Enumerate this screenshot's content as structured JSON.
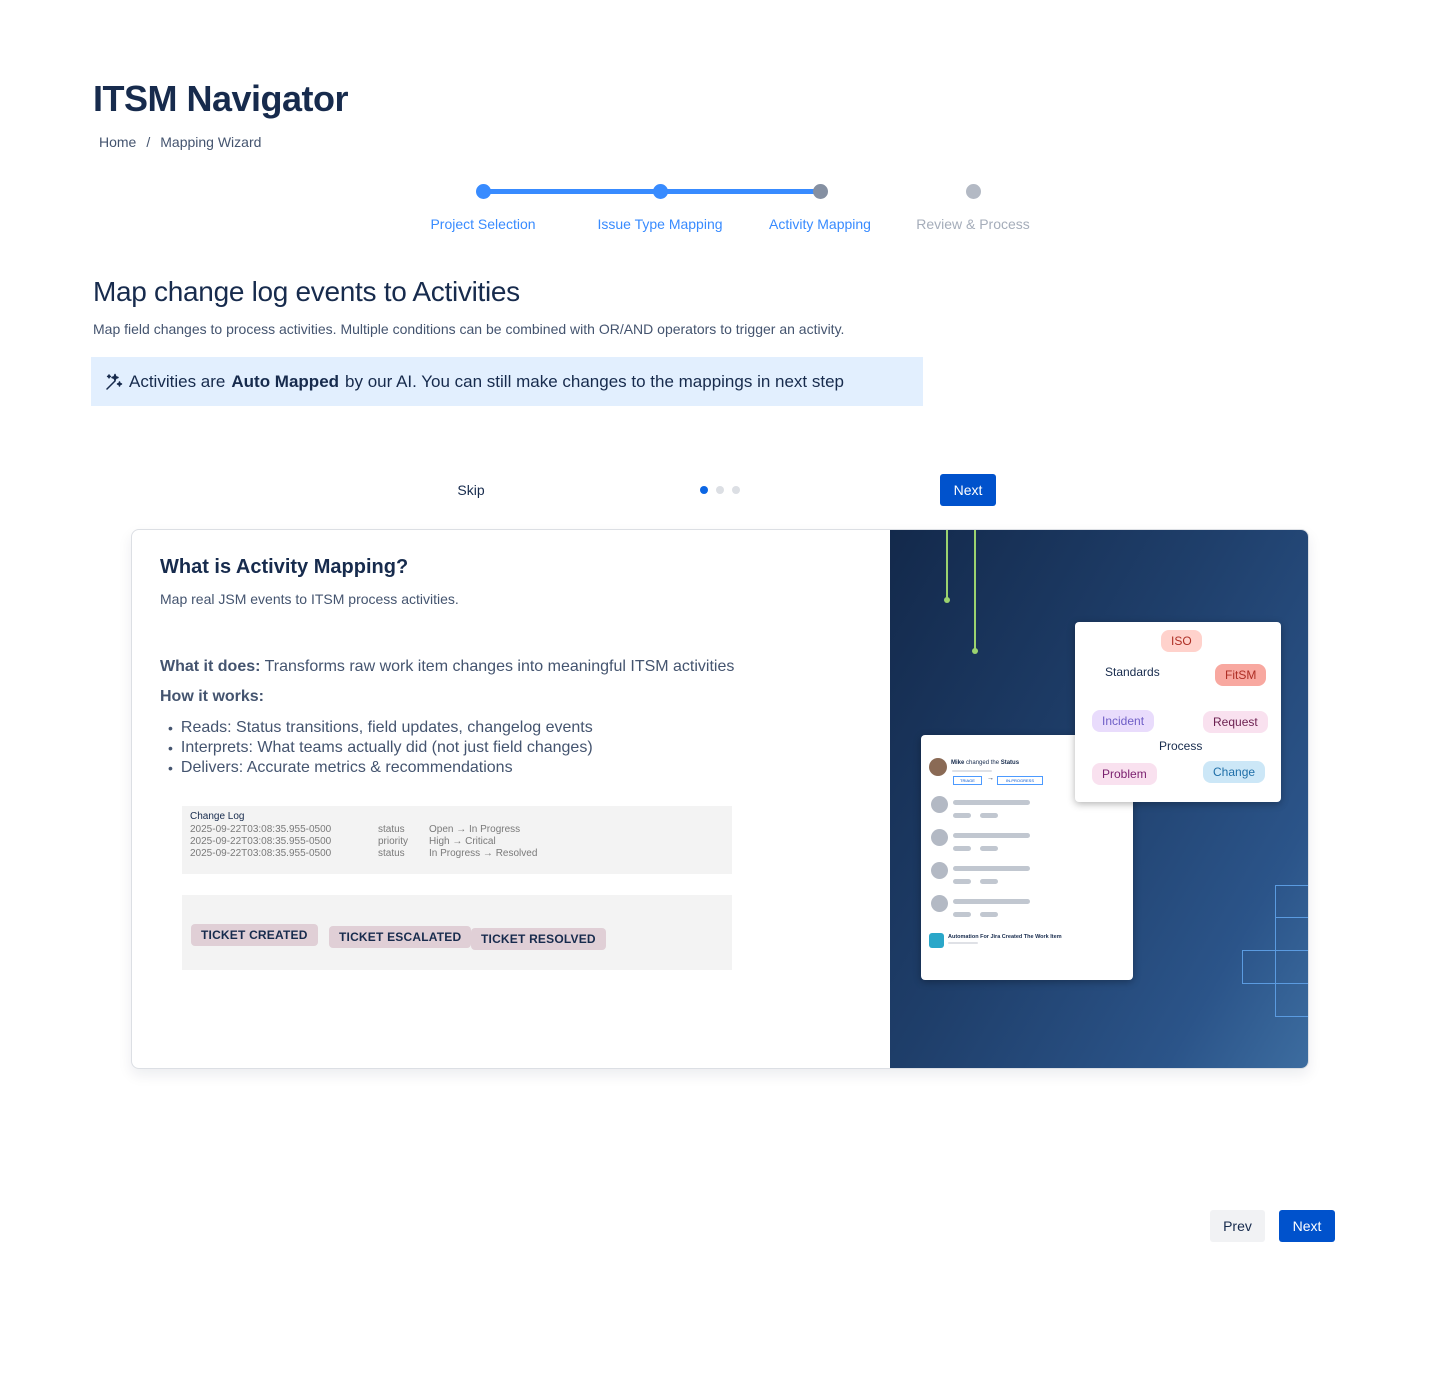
{
  "app": {
    "title": "ITSM Navigator"
  },
  "breadcrumb": {
    "home": "Home",
    "separator": "/",
    "current": "Mapping Wizard"
  },
  "stepper": {
    "steps": [
      {
        "label": "Project Selection",
        "state": "complete"
      },
      {
        "label": "Issue Type Mapping",
        "state": "complete"
      },
      {
        "label": "Activity Mapping",
        "state": "current"
      },
      {
        "label": "Review & Process",
        "state": "upcoming"
      }
    ],
    "active_color": "#388bff",
    "inactive_color": "#b3b9c4"
  },
  "section": {
    "title": "Map change log events to Activities",
    "description": "Map field changes to process activities. Multiple conditions can be combined with OR/AND operators to trigger an activity."
  },
  "ai_banner": {
    "icon": "sparkle-icon",
    "prefix": "Activities are",
    "bold": "Auto Mapped",
    "suffix": "by our AI. You can still make changes to the mappings in next step"
  },
  "carousel": {
    "skip_label": "Skip",
    "next_label": "Next",
    "dots": 3,
    "active_dot": 1
  },
  "card": {
    "title": "What is Activity Mapping?",
    "subtitle": "Map real JSM events to ITSM process activities.",
    "what_label": "What it does:",
    "what_text": "Transforms raw work item changes into meaningful ITSM activities",
    "how_label": "How it works:",
    "bullets": [
      "Reads: Status transitions, field updates, changelog events",
      "Interprets: What teams actually did (not just field changes)",
      "Delivers: Accurate metrics & recommendations"
    ],
    "changelog": {
      "title": "Change Log",
      "rows": [
        {
          "time": "2025-09-22T03:08:35.955-0500",
          "field": "status",
          "change": "Open → In Progress"
        },
        {
          "time": "2025-09-22T03:08:35.955-0500",
          "field": "priority",
          "change": "High → Critical"
        },
        {
          "time": "2025-09-22T03:08:35.955-0500",
          "field": "status",
          "change": "In Progress →  Resolved"
        }
      ]
    },
    "tags": [
      "TICKET CREATED",
      "TICKET ESCALATED",
      "TICKET RESOLVED"
    ]
  },
  "illustration": {
    "log_panel": {
      "user": "Mike",
      "action": "changed the",
      "field": "Status",
      "from": "TRIAGE",
      "to": "IN-PROGRESS",
      "automation_title": "Automation For Jira Created The Work Item"
    },
    "standards_panel": {
      "standards_label": "Standards",
      "process_label": "Process",
      "pills": [
        "ISO",
        "FitSM",
        "Incident",
        "Request",
        "Problem",
        "Change"
      ]
    }
  },
  "footer_nav": {
    "prev_label": "Prev",
    "next_label": "Next"
  }
}
